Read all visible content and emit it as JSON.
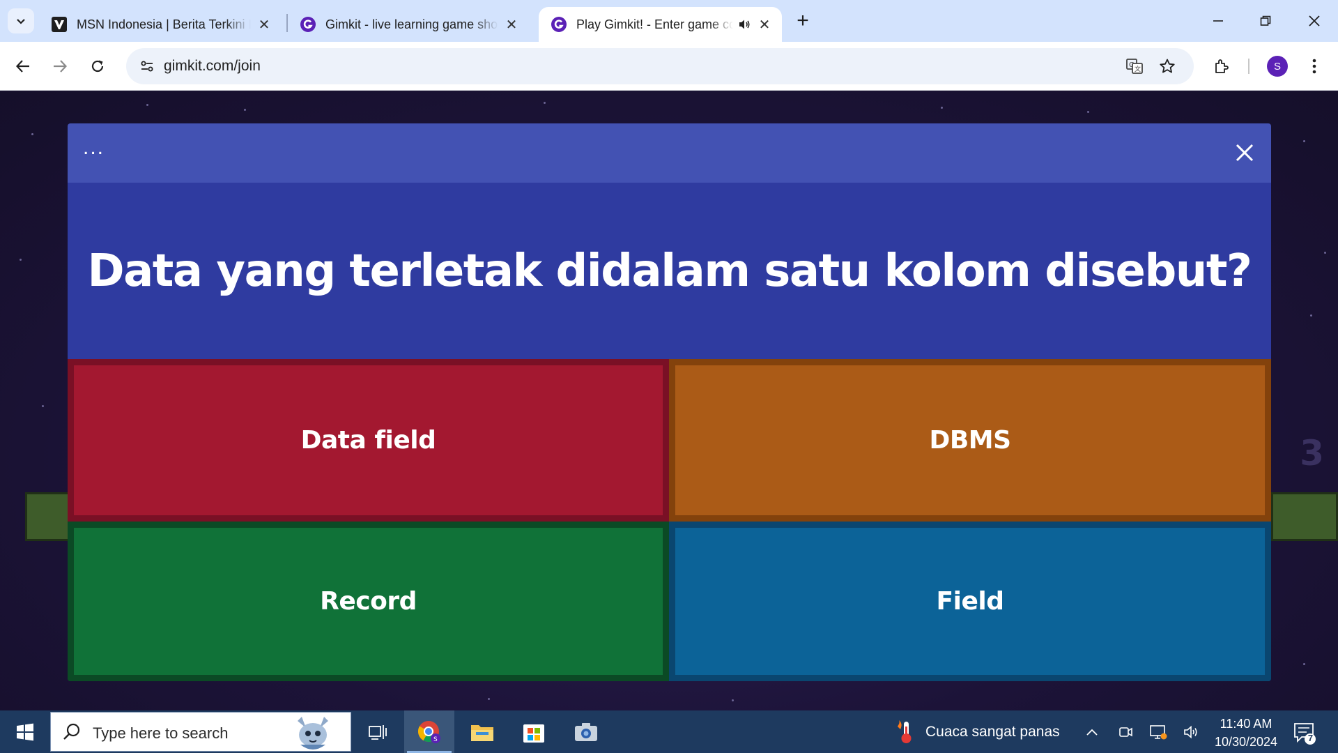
{
  "browser": {
    "tabs": [
      {
        "title": "MSN Indonesia | Berita Terkini H",
        "active": false
      },
      {
        "title": "Gimkit - live learning game sho",
        "active": false
      },
      {
        "title": "Play Gimkit! - Enter game co",
        "active": true,
        "audio": true
      }
    ],
    "address": "gimkit.com/join",
    "profile_initial": "S"
  },
  "game": {
    "menu_label": "...",
    "question": "Data yang terletak didalam satu kolom disebut?",
    "answers": [
      {
        "label": "Data field",
        "color": "#a31830"
      },
      {
        "label": "DBMS",
        "color": "#ab5b17"
      },
      {
        "label": "Record",
        "color": "#107238"
      },
      {
        "label": "Field",
        "color": "#0c6398"
      }
    ],
    "background_number": "3"
  },
  "taskbar": {
    "search_placeholder": "Type here to search",
    "weather": "Cuaca sangat panas",
    "time": "11:40 AM",
    "date": "10/30/2024",
    "notification_count": "7"
  }
}
